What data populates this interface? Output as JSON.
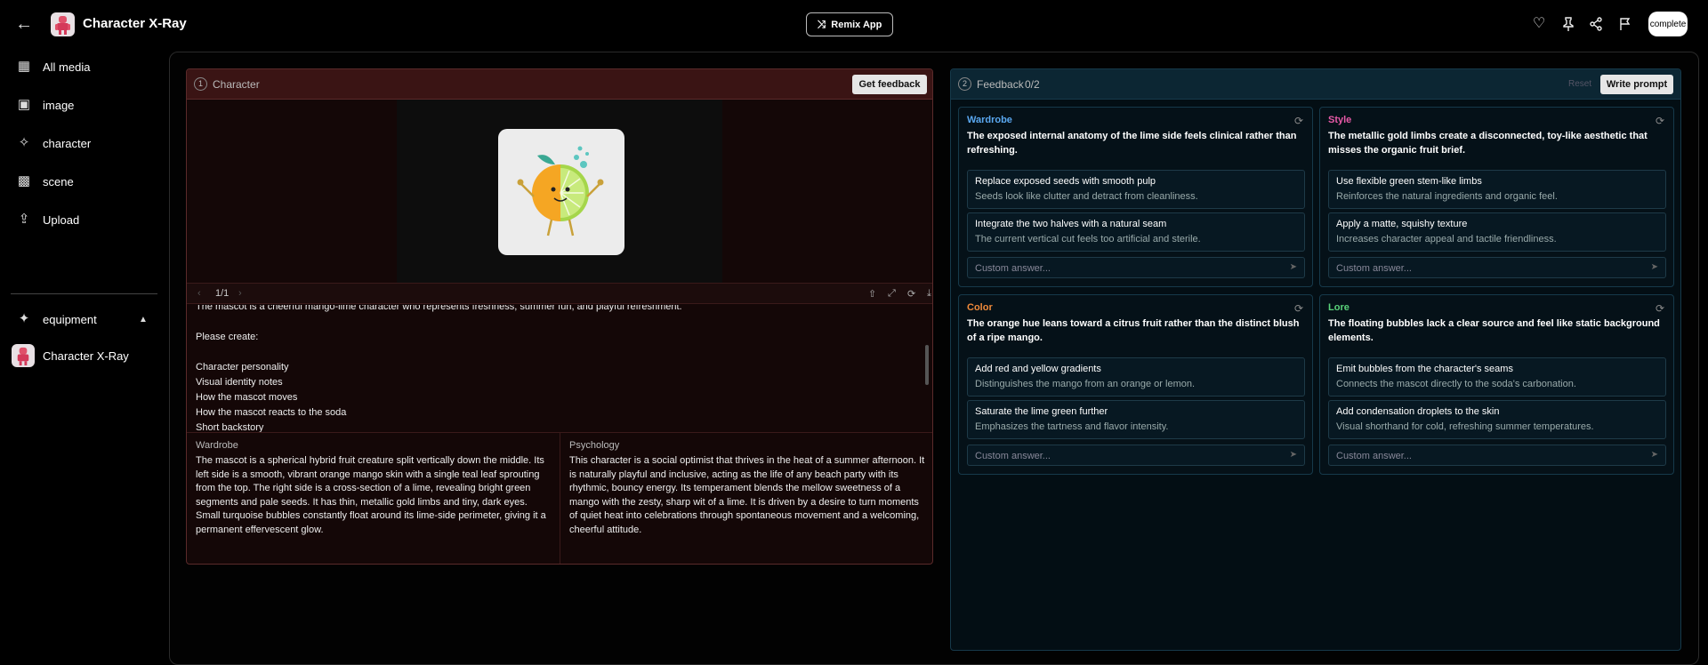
{
  "header": {
    "title": "Character X-Ray",
    "remix_label": "Remix App",
    "complete_label": "complete"
  },
  "sidebar": {
    "items": [
      {
        "label": "All media",
        "icon": "grid-icon"
      },
      {
        "label": "image",
        "icon": "image-icon"
      },
      {
        "label": "character",
        "icon": "person-icon"
      },
      {
        "label": "scene",
        "icon": "film-icon"
      },
      {
        "label": "Upload",
        "icon": "upload-folder-icon"
      }
    ],
    "section_label": "equipment",
    "app_item_label": "Character X-Ray"
  },
  "character_panel": {
    "step": "1",
    "title": "Character",
    "feedback_button": "Get feedback",
    "pager": "1/1",
    "prompt_lines": [
      "The mascot is a cheerful mango-lime character who represents freshness, summer fun, and playful refreshment.",
      "",
      "Please create:",
      "",
      "Character personality",
      "Visual identity notes",
      "How the mascot moves",
      "How the mascot reacts to the soda",
      "Short backstory"
    ],
    "wardrobe": {
      "heading": "Wardrobe",
      "text": "The mascot is a spherical hybrid fruit creature split vertically down the middle. Its left side is a smooth, vibrant orange mango skin with a single teal leaf sprouting from the top. The right side is a cross-section of a lime, revealing bright green segments and pale seeds. It has thin, metallic gold limbs and tiny, dark eyes. Small turquoise bubbles constantly float around its lime-side perimeter, giving it a permanent effervescent glow."
    },
    "psychology": {
      "heading": "Psychology",
      "text": "This character is a social optimist that thrives in the heat of a summer afternoon. It is naturally playful and inclusive, acting as the life of any beach party with its rhythmic, bouncy energy. Its temperament blends the mellow sweetness of a mango with the zesty, sharp wit of a lime. It is driven by a desire to turn moments of quiet heat into celebrations through spontaneous movement and a welcoming, cheerful attitude."
    }
  },
  "feedback_panel": {
    "step": "2",
    "title": "Feedback",
    "count": "0/2",
    "reset_label": "Reset",
    "write_label": "Write prompt",
    "custom_placeholder": "Custom answer...",
    "cards": [
      {
        "category": "Wardrobe",
        "color": "#5aa8f0",
        "question": "The exposed internal anatomy of the lime side feels clinical rather than refreshing.",
        "options": [
          {
            "title": "Replace exposed seeds with smooth pulp",
            "sub": "Seeds look like clutter and detract from cleanliness."
          },
          {
            "title": "Integrate the two halves with a natural seam",
            "sub": "The current vertical cut feels too artificial and sterile."
          }
        ]
      },
      {
        "category": "Style",
        "color": "#e85aa8",
        "question": "The metallic gold limbs create a disconnected, toy-like aesthetic that misses the organic fruit brief.",
        "options": [
          {
            "title": "Use flexible green stem-like limbs",
            "sub": "Reinforces the natural ingredients and organic feel."
          },
          {
            "title": "Apply a matte, squishy texture",
            "sub": "Increases character appeal and tactile friendliness."
          }
        ]
      },
      {
        "category": "Color",
        "color": "#f08a3a",
        "question": "The orange hue leans toward a citrus fruit rather than the distinct blush of a ripe mango.",
        "options": [
          {
            "title": "Add red and yellow gradients",
            "sub": "Distinguishes the mango from an orange or lemon."
          },
          {
            "title": "Saturate the lime green further",
            "sub": "Emphasizes the tartness and flavor intensity."
          }
        ]
      },
      {
        "category": "Lore",
        "color": "#5ad27a",
        "question": "The floating bubbles lack a clear source and feel like static background elements.",
        "options": [
          {
            "title": "Emit bubbles from the character's seams",
            "sub": "Connects the mascot directly to the soda's carbonation."
          },
          {
            "title": "Add condensation droplets to the skin",
            "sub": "Visual shorthand for cold, refreshing summer temperatures."
          }
        ]
      }
    ]
  }
}
